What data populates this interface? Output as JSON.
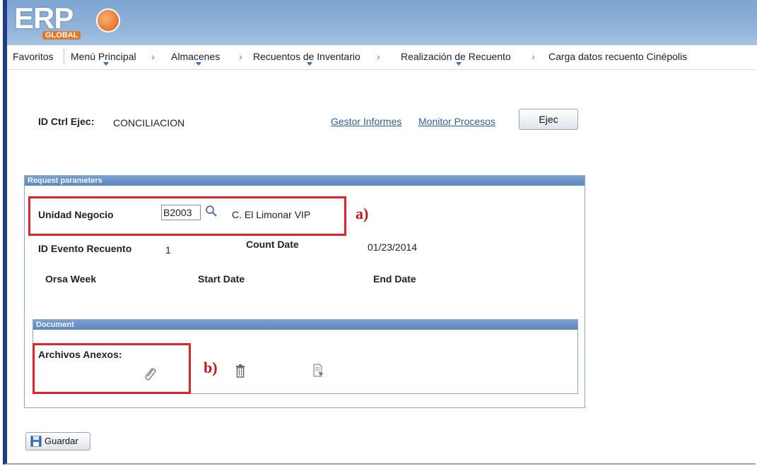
{
  "app": {
    "logo_text": "ERP",
    "logo_sub": "GLOBAL"
  },
  "nav": {
    "items": [
      "Favoritos",
      "Menú Principal",
      "Almacenes",
      "Recuentos de Inventario",
      "Realización de Recuento",
      "Carga datos recuento Cinépolis"
    ],
    "separator": "›"
  },
  "run_control": {
    "label": "ID Ctrl Ejec:",
    "value": "CONCILIACION",
    "report_manager_link": "Gestor Informes",
    "process_monitor_link": "Monitor Procesos",
    "run_button": "Ejec"
  },
  "request_params": {
    "header": "Request parameters",
    "business_unit_label": "Unidad Negocio",
    "business_unit_value": "B2003",
    "business_unit_desc": "C. El Limonar VIP",
    "event_id_label": "ID Evento Recuento",
    "event_id_value": "1",
    "count_date_label": "Count Date",
    "count_date_value": "01/23/2014",
    "orsa_week_label": "Orsa Week",
    "start_date_label": "Start Date",
    "end_date_label": "End Date"
  },
  "document": {
    "header": "Document",
    "attachments_label": "Archivos Anexos:"
  },
  "annotations": {
    "a": "a)",
    "b": "b)"
  },
  "save_button": "Guardar",
  "icons": {
    "lookup": "magnifier-icon",
    "attach": "paperclip-icon",
    "delete": "trash-icon",
    "view": "document-view-icon",
    "save": "save-icon"
  },
  "colors": {
    "annotation_red": "#e0232a",
    "link_blue": "#2a5ea8",
    "header_blue": "#5d86bd"
  }
}
